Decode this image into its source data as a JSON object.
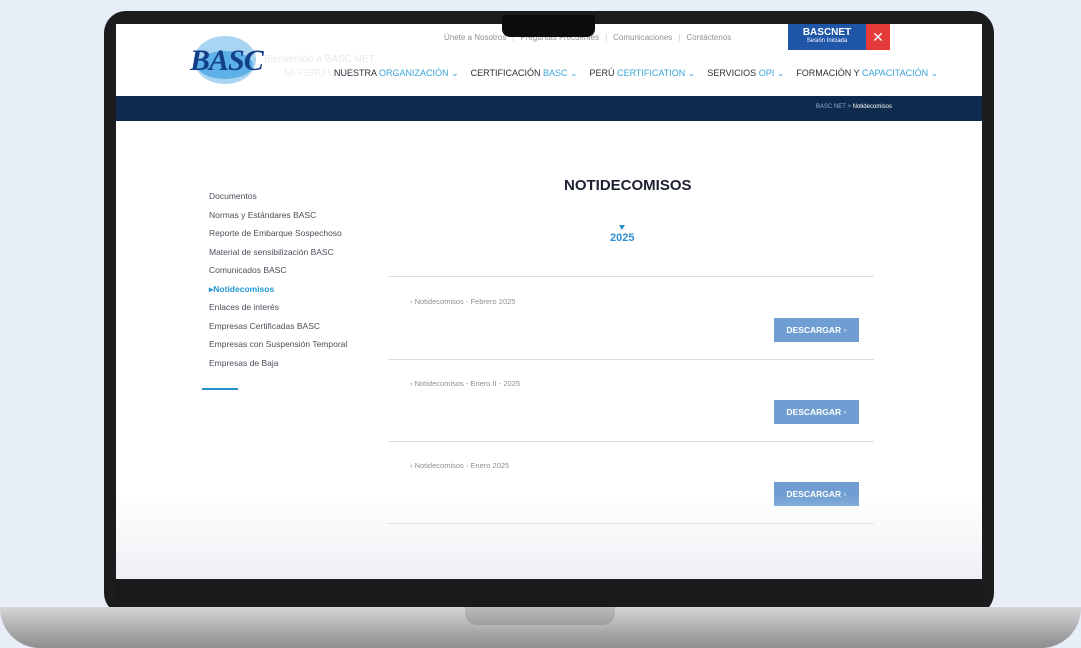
{
  "header": {
    "logo_text": "BASC",
    "welcome": "Bienvenido a BASC NET",
    "welcome_sub": "Mi PERU USA",
    "top_links": [
      "Únete a Nosotros",
      "Preguntas Frecuentes",
      "Comunicaciones",
      "Contáctenos"
    ],
    "bascnet_title": "BASCNET",
    "bascnet_sub": "Sesión Iniciada",
    "close_label": "✕",
    "nav": [
      {
        "main": "NUESTRA",
        "accent": "ORGANIZACIÓN"
      },
      {
        "main": "CERTIFICACIÓN",
        "accent": "BASC"
      },
      {
        "main": "PERÚ",
        "accent": "CERTIFICATION"
      },
      {
        "main": "SERVICIOS",
        "accent": "OPI"
      },
      {
        "main": "FORMACIÓN Y",
        "accent": "CAPACITACIÓN"
      }
    ]
  },
  "breadcrumb": {
    "root": "BASC NET",
    "sep": ">",
    "current": "Notidecomisos"
  },
  "sidebar": {
    "items": [
      "Documentos",
      "Normas y Estándares BASC",
      "Reporte de Embarque Sospechoso",
      "Material de sensibilización BASC",
      "Comunicados BASC",
      "Notidecomisos",
      "Enlaces de interés",
      "Empresas Certificadas BASC",
      "Empresas con Suspensión Temporal",
      "Empresas de Baja"
    ],
    "active_prefix": "▸"
  },
  "main": {
    "title": "NOTIDECOMISOS",
    "year": "2025",
    "download_label": "DESCARGAR",
    "documents": [
      "Notidecomisos - Febrero 2025",
      "Notidecomisos - Enero II - 2025",
      "Notidecomisos - Enero 2025"
    ]
  },
  "colors": {
    "navy": "#0e2a4c",
    "accent": "#2196d3",
    "button": "#6f9fd2",
    "close": "#e43a3a"
  }
}
